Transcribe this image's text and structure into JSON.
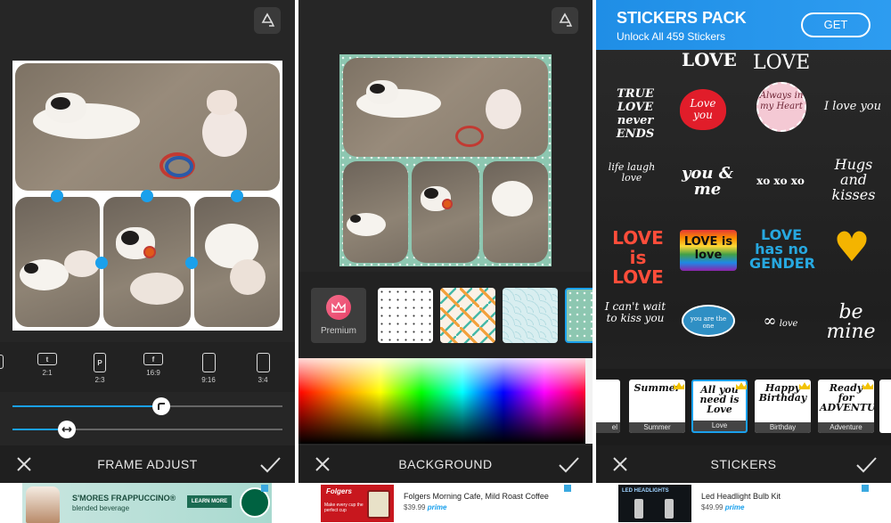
{
  "panel1": {
    "ratios": [
      {
        "label": "2:1",
        "icon": "twitter-icon",
        "glyph": "t"
      },
      {
        "label": "2:3",
        "icon": "pinterest-icon",
        "glyph": "P"
      },
      {
        "label": "16:9",
        "icon": "facebook-icon",
        "glyph": "f"
      },
      {
        "label": "9:16",
        "icon": "portrait-ratio-icon",
        "glyph": ""
      },
      {
        "label": "3:4",
        "icon": "portrait-ratio-icon",
        "glyph": ""
      }
    ],
    "slider1_level": 0.55,
    "slider2_level": 0.2,
    "title": "FRAME ADJUST",
    "ad": {
      "headline": "S'MORES FRAPPUCCINO",
      "reg": "®",
      "sub": "blended beverage",
      "cta": "LEARN MORE"
    }
  },
  "panel2": {
    "premium_label": "Premium",
    "title": "BACKGROUND",
    "ad": {
      "brand": "Folgers",
      "tagline": "Make every cup the perfect cup",
      "product": "Folgers Morning Cafe, Mild Roast Coffee",
      "price": "$39.99",
      "prime": "prime"
    }
  },
  "panel3": {
    "banner": {
      "title": "STICKERS PACK",
      "subtitle": "Unlock All 459 Stickers",
      "button": "GET"
    },
    "stickers": [
      "LOVE",
      "LOVE",
      "TRUE LOVE never ENDS",
      "Love you",
      "Always in my Heart",
      "I love you",
      "life laugh love",
      "you & me",
      "xo xo xo",
      "Hugs and kisses",
      "LOVE is LOVE",
      "LOVE is love",
      "LOVE has no GENDER",
      "♥",
      "I can't wait to kiss you",
      "you are the one",
      "love",
      "be mine"
    ],
    "categories": [
      "Summer",
      "Love",
      "Birthday",
      "Adventure"
    ],
    "category_art": [
      "Summer",
      "All you need is Love",
      "Happy Birthday",
      "Ready for ADVENTURES"
    ],
    "first_partial_caption": "el",
    "title": "STICKERS",
    "ad": {
      "product": "Led Headlight Bulb Kit",
      "price": "$49.99",
      "prime": "prime",
      "logo_text": "LED HEADLIGHTS"
    }
  },
  "colors": {
    "accent": "#1aa0ec",
    "banner": "#1f8ee6",
    "premium": "#f0557c"
  }
}
